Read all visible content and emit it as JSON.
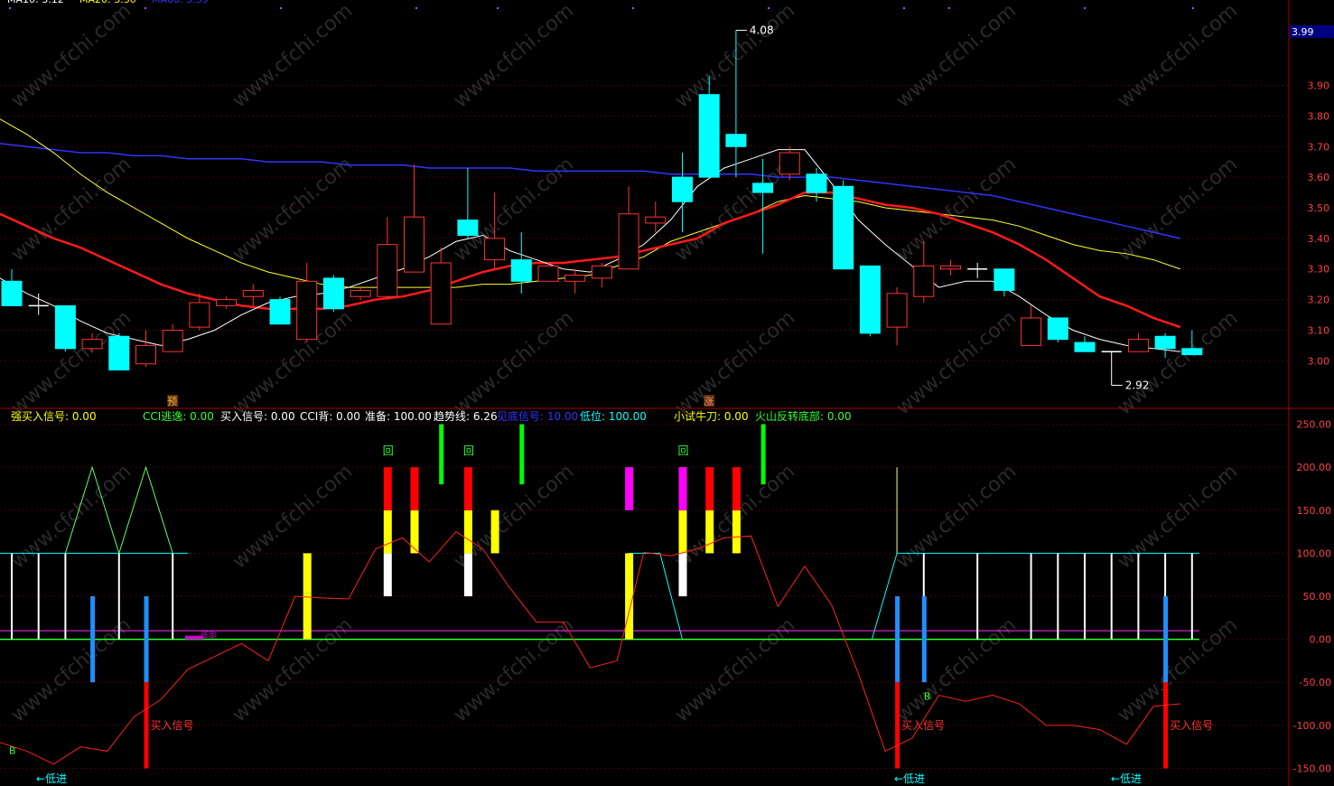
{
  "top_legend": [
    {
      "label": "MA10: 3.12",
      "color": "#ffffff"
    },
    {
      "label": "MA20: 3.30",
      "color": "#ffff00"
    },
    {
      "label": "MA60: 3.39",
      "color": "#3333ff"
    }
  ],
  "price_axis": {
    "current_price_tag": "3.99",
    "ticks": [
      {
        "v": 3.9,
        "label": "3.90"
      },
      {
        "v": 3.8,
        "label": "3.80"
      },
      {
        "v": 3.7,
        "label": "3.70"
      },
      {
        "v": 3.6,
        "label": "3.60"
      },
      {
        "v": 3.5,
        "label": "3.50"
      },
      {
        "v": 3.4,
        "label": "3.40"
      },
      {
        "v": 3.3,
        "label": "3.30"
      },
      {
        "v": 3.2,
        "label": "3.20"
      },
      {
        "v": 3.1,
        "label": "3.10"
      },
      {
        "v": 3.0,
        "label": "3.00"
      }
    ],
    "high_label": "4.08",
    "low_label": "2.92"
  },
  "indicator_axis": {
    "ticks": [
      {
        "v": 250,
        "label": "250.00"
      },
      {
        "v": 200,
        "label": "200.00"
      },
      {
        "v": 150,
        "label": "150.00"
      },
      {
        "v": 100,
        "label": "100.00"
      },
      {
        "v": 50,
        "label": "50.00"
      },
      {
        "v": 0,
        "label": "0.00"
      },
      {
        "v": -50,
        "label": "-50.00"
      },
      {
        "v": -100,
        "label": "-100.00"
      },
      {
        "v": -150,
        "label": "-150.00"
      }
    ]
  },
  "indicator_legend": [
    {
      "label": "强买入信号: 0.00",
      "color": "#ffff00"
    },
    {
      "label": "CCI逃逸: 0.00",
      "color": "#33ff33"
    },
    {
      "label": "买入信号: 0.00",
      "color": "#ffffff"
    },
    {
      "label": "CCI背: 0.00",
      "color": "#ffffff"
    },
    {
      "label": "准备: 100.00",
      "color": "#ffffff"
    },
    {
      "label": "趋势线: 6.26",
      "color": "#ffffff"
    },
    {
      "label": "见底信号: 10.00",
      "color": "#3333ff"
    },
    {
      "label": "低位: 100.00",
      "color": "#00ffff"
    },
    {
      "label": "小试牛刀: 0.00",
      "color": "#ffff00"
    },
    {
      "label": "火山反转底部: 0.00",
      "color": "#33ff33"
    }
  ],
  "markers": {
    "yu": "预",
    "zhang": "涨",
    "hui": "回",
    "buy_signal": "买入信号",
    "b": "B",
    "low_entry": "←低进",
    "chuangji": "底部"
  },
  "watermark": "www.cfchi.com",
  "colors": {
    "up": "#ff3232",
    "down": "#00ffff",
    "ma_white": "#ffffff",
    "ma_yellow": "#ffff33",
    "ma_blue": "#3333ff",
    "ma_red": "#ff1a1a",
    "grid": "#7a0000",
    "axis_text": "#ff4040"
  },
  "chart_data": {
    "type": "candlestick",
    "price_range": [
      2.88,
      4.12
    ],
    "indicator_range": [
      -160,
      260
    ],
    "candles": [
      [
        3.26,
        3.18,
        3.3,
        3.18
      ],
      [
        3.18,
        3.18,
        3.22,
        3.15
      ],
      [
        3.18,
        3.04,
        3.18,
        3.03
      ],
      [
        3.04,
        3.07,
        3.09,
        3.03
      ],
      [
        3.08,
        2.97,
        3.09,
        2.97
      ],
      [
        2.99,
        3.05,
        3.1,
        2.98
      ],
      [
        3.03,
        3.1,
        3.12,
        3.03
      ],
      [
        3.11,
        3.19,
        3.22,
        3.1
      ],
      [
        3.18,
        3.2,
        3.21,
        3.17
      ],
      [
        3.21,
        3.23,
        3.25,
        3.18
      ],
      [
        3.2,
        3.12,
        3.21,
        3.12
      ],
      [
        3.07,
        3.26,
        3.32,
        3.06
      ],
      [
        3.27,
        3.17,
        3.28,
        3.16
      ],
      [
        3.21,
        3.23,
        3.24,
        3.2
      ],
      [
        3.21,
        3.38,
        3.47,
        3.2
      ],
      [
        3.29,
        3.47,
        3.64,
        3.29
      ],
      [
        3.12,
        3.32,
        3.37,
        3.12
      ],
      [
        3.46,
        3.41,
        3.63,
        3.4
      ],
      [
        3.33,
        3.4,
        3.55,
        3.3
      ],
      [
        3.33,
        3.26,
        3.42,
        3.22
      ],
      [
        3.26,
        3.31,
        3.32,
        3.26
      ],
      [
        3.26,
        3.28,
        3.3,
        3.22
      ],
      [
        3.27,
        3.31,
        3.32,
        3.24
      ],
      [
        3.3,
        3.48,
        3.57,
        3.3
      ],
      [
        3.45,
        3.47,
        3.52,
        3.42
      ],
      [
        3.6,
        3.52,
        3.68,
        3.42
      ],
      [
        3.87,
        3.6,
        3.93,
        3.6
      ],
      [
        3.74,
        3.7,
        4.08,
        3.6
      ],
      [
        3.58,
        3.55,
        3.66,
        3.35
      ],
      [
        3.61,
        3.68,
        3.7,
        3.59
      ],
      [
        3.61,
        3.55,
        3.63,
        3.52
      ],
      [
        3.57,
        3.3,
        3.59,
        3.3
      ],
      [
        3.31,
        3.09,
        3.31,
        3.08
      ],
      [
        3.11,
        3.22,
        3.24,
        3.05
      ],
      [
        3.21,
        3.31,
        3.39,
        3.19
      ],
      [
        3.3,
        3.31,
        3.33,
        3.28
      ],
      [
        3.3,
        3.3,
        3.32,
        3.27
      ],
      [
        3.3,
        3.23,
        3.3,
        3.21
      ],
      [
        3.05,
        3.14,
        3.18,
        3.05
      ],
      [
        3.14,
        3.07,
        3.14,
        3.06
      ],
      [
        3.06,
        3.03,
        3.08,
        3.03
      ],
      [
        3.03,
        3.03,
        3.03,
        2.92
      ],
      [
        3.03,
        3.07,
        3.09,
        3.03
      ],
      [
        3.08,
        3.04,
        3.09,
        3.01
      ],
      [
        3.04,
        3.02,
        3.1,
        3.02
      ]
    ],
    "ma10": [
      3.27,
      3.22,
      3.18,
      3.13,
      3.09,
      3.07,
      3.05,
      3.07,
      3.1,
      3.15,
      3.19,
      3.21,
      3.22,
      3.24,
      3.27,
      3.3,
      3.34,
      3.39,
      3.41,
      3.36,
      3.33,
      3.3,
      3.29,
      3.33,
      3.38,
      3.46,
      3.57,
      3.63,
      3.66,
      3.69,
      3.69,
      3.58,
      3.46,
      3.38,
      3.31,
      3.24,
      3.26,
      3.26,
      3.21,
      3.15,
      3.1,
      3.07,
      3.05,
      3.04,
      3.03
    ],
    "ma20": [
      3.79,
      3.74,
      3.68,
      3.61,
      3.55,
      3.5,
      3.45,
      3.4,
      3.36,
      3.32,
      3.29,
      3.27,
      3.25,
      3.24,
      3.24,
      3.24,
      3.24,
      3.24,
      3.25,
      3.25,
      3.26,
      3.27,
      3.28,
      3.31,
      3.34,
      3.39,
      3.42,
      3.45,
      3.48,
      3.52,
      3.54,
      3.53,
      3.52,
      3.5,
      3.49,
      3.48,
      3.47,
      3.46,
      3.44,
      3.41,
      3.38,
      3.36,
      3.35,
      3.33,
      3.3
    ],
    "ma60": [
      3.71,
      3.7,
      3.69,
      3.68,
      3.68,
      3.67,
      3.67,
      3.66,
      3.66,
      3.66,
      3.65,
      3.65,
      3.65,
      3.64,
      3.64,
      3.64,
      3.63,
      3.63,
      3.63,
      3.63,
      3.62,
      3.62,
      3.62,
      3.62,
      3.62,
      3.61,
      3.61,
      3.61,
      3.61,
      3.6,
      3.6,
      3.6,
      3.59,
      3.58,
      3.57,
      3.56,
      3.55,
      3.54,
      3.52,
      3.5,
      3.48,
      3.46,
      3.44,
      3.42,
      3.4
    ],
    "mar": [
      3.48,
      3.44,
      3.4,
      3.37,
      3.33,
      3.29,
      3.25,
      3.22,
      3.2,
      3.18,
      3.17,
      3.17,
      3.17,
      3.18,
      3.2,
      3.21,
      3.23,
      3.26,
      3.29,
      3.31,
      3.32,
      3.32,
      3.33,
      3.34,
      3.36,
      3.38,
      3.4,
      3.45,
      3.48,
      3.51,
      3.55,
      3.55,
      3.53,
      3.51,
      3.5,
      3.48,
      3.45,
      3.42,
      3.38,
      3.33,
      3.27,
      3.21,
      3.18,
      3.14,
      3.11
    ],
    "cci": [
      -120,
      -130,
      -145,
      -125,
      -130,
      -90,
      -70,
      -35,
      -20,
      -5,
      -25,
      50,
      48,
      47,
      105,
      118,
      90,
      125,
      105,
      60,
      20,
      20,
      -33,
      -25,
      101,
      97,
      105,
      118,
      120,
      38,
      85,
      40,
      -40,
      -130,
      -115,
      -65,
      -72,
      -65,
      -75,
      -100,
      -100,
      -105,
      -122,
      -78,
      -75
    ],
    "white_bars": [
      0,
      1,
      2,
      4,
      6,
      34,
      36,
      38,
      39,
      40,
      41,
      42,
      43,
      44
    ],
    "red_bars": [
      14,
      15,
      17,
      25,
      26,
      27
    ],
    "yellow_bars": [
      11,
      14,
      15,
      17,
      18,
      23,
      25,
      26,
      27
    ],
    "white_stack_bars": [
      14,
      17,
      25
    ],
    "magenta_bars": [
      23,
      25
    ],
    "green_top_bars": [
      16,
      19,
      28
    ],
    "blue_bars": [
      3,
      5,
      33,
      34,
      43
    ],
    "buy_red_bars": [
      5,
      33,
      43
    ]
  }
}
